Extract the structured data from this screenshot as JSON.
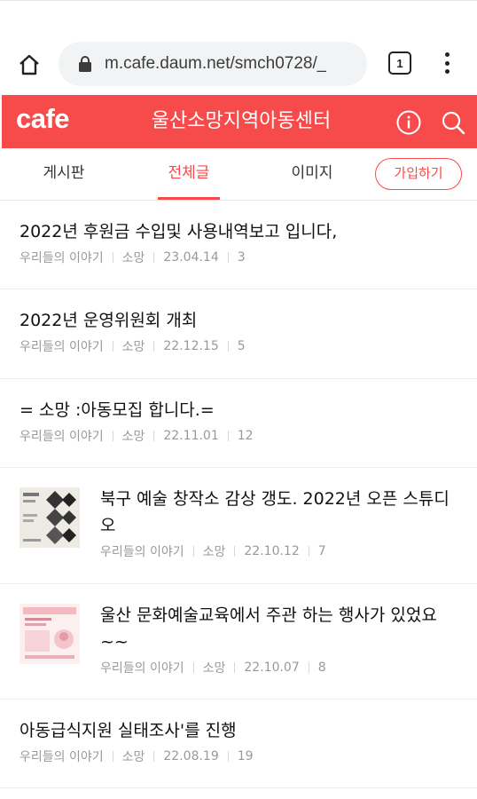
{
  "browser": {
    "url": "m.cafe.daum.net/smch0728/_",
    "tab_count": "1"
  },
  "cafe": {
    "logo": "cafe",
    "title": "울산소망지역아동센터",
    "brand_color": "#f74b4b"
  },
  "tabs": [
    {
      "label": "게시판",
      "active": false
    },
    {
      "label": "전체글",
      "active": true
    },
    {
      "label": "이미지",
      "active": false
    }
  ],
  "join_label": "가입하기",
  "posts": [
    {
      "title": "2022년 후원금 수입및 사용내역보고 입니다,",
      "board": "우리들의 이야기",
      "author": "소망",
      "date": "23.04.14",
      "comments": "3",
      "thumb": false
    },
    {
      "title": "2022년 운영위원회 개최",
      "board": "우리들의 이야기",
      "author": "소망",
      "date": "22.12.15",
      "comments": "5",
      "thumb": false
    },
    {
      "title": "= 소망 :아동모집 합니다.=",
      "board": "우리들의 이야기",
      "author": "소망",
      "date": "22.11.01",
      "comments": "12",
      "thumb": false
    },
    {
      "title": "북구 예술 창작소 감상 갱도. 2022년 오픈 스튜디오",
      "board": "우리들의 이야기",
      "author": "소망",
      "date": "22.10.12",
      "comments": "7",
      "thumb": true
    },
    {
      "title": "울산 문화예술교육에서 주관 하는 행사가 있었요~~",
      "board": "우리들의 이야기",
      "author": "소망",
      "date": "22.10.07",
      "comments": "8",
      "thumb": true
    },
    {
      "title": "아동급식지원 실태조사'를 진행",
      "board": "우리들의 이야기",
      "author": "소망",
      "date": "22.08.19",
      "comments": "19",
      "thumb": false
    }
  ]
}
